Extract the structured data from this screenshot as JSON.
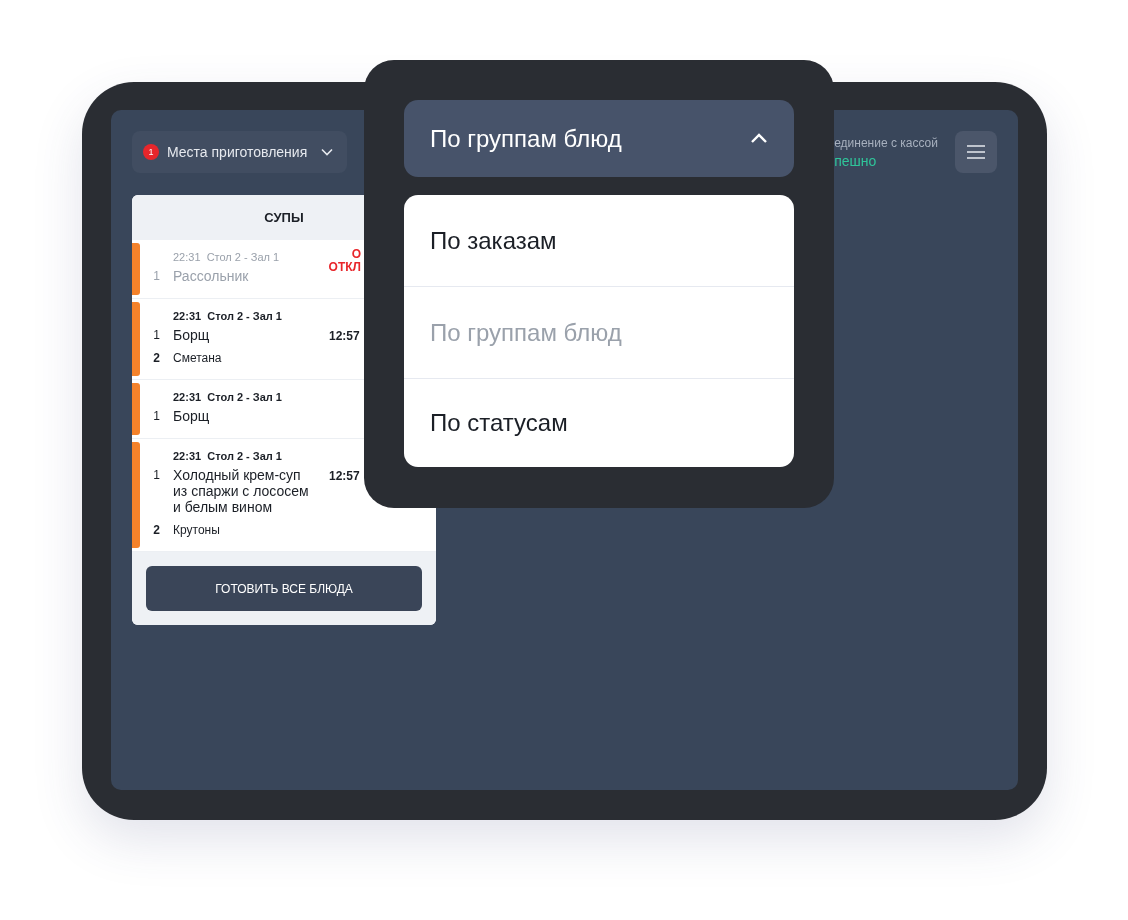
{
  "toolbar": {
    "places_button": {
      "badge": "1",
      "label": "Места приготовления"
    },
    "connection": {
      "label": "единение с кассой",
      "status": "пешно"
    }
  },
  "group": {
    "title": "СУПЫ",
    "orders": [
      {
        "time": "22:31",
        "table": "Стол 2 - Зал 1",
        "dimmed": true,
        "status": [
          "О",
          "ОТКЛ"
        ],
        "items": [
          {
            "kind": "dish",
            "qty": "1",
            "name": "Рассольник"
          }
        ]
      },
      {
        "time": "22:31",
        "table": "Стол 2 - Зал 1",
        "dimmed": false,
        "elapsed": "12:57",
        "items": [
          {
            "kind": "dish",
            "qty": "1",
            "name": "Борщ"
          },
          {
            "kind": "modifier",
            "qty": "2",
            "name": "Сметана"
          }
        ]
      },
      {
        "time": "22:31",
        "table": "Стол 2 - Зал 1",
        "dimmed": false,
        "items": [
          {
            "kind": "dish",
            "qty": "1",
            "name": "Борщ"
          }
        ]
      },
      {
        "time": "22:31",
        "table": "Стол 2 - Зал 1",
        "dimmed": false,
        "elapsed": "12:57",
        "items": [
          {
            "kind": "dish",
            "qty": "1",
            "name": "Холодный крем-суп из спаржи с лососем и белым вином"
          },
          {
            "kind": "modifier",
            "qty": "2",
            "name": "Крутоны"
          }
        ]
      }
    ],
    "action": "ГОТОВИТЬ ВСЕ БЛЮДА"
  },
  "grouping_dropdown": {
    "value": "По группам блюд",
    "expanded": true,
    "options": [
      {
        "label": "По заказам",
        "selected": false
      },
      {
        "label": "По группам блюд",
        "selected": true
      },
      {
        "label": "По статусам",
        "selected": false
      }
    ]
  }
}
